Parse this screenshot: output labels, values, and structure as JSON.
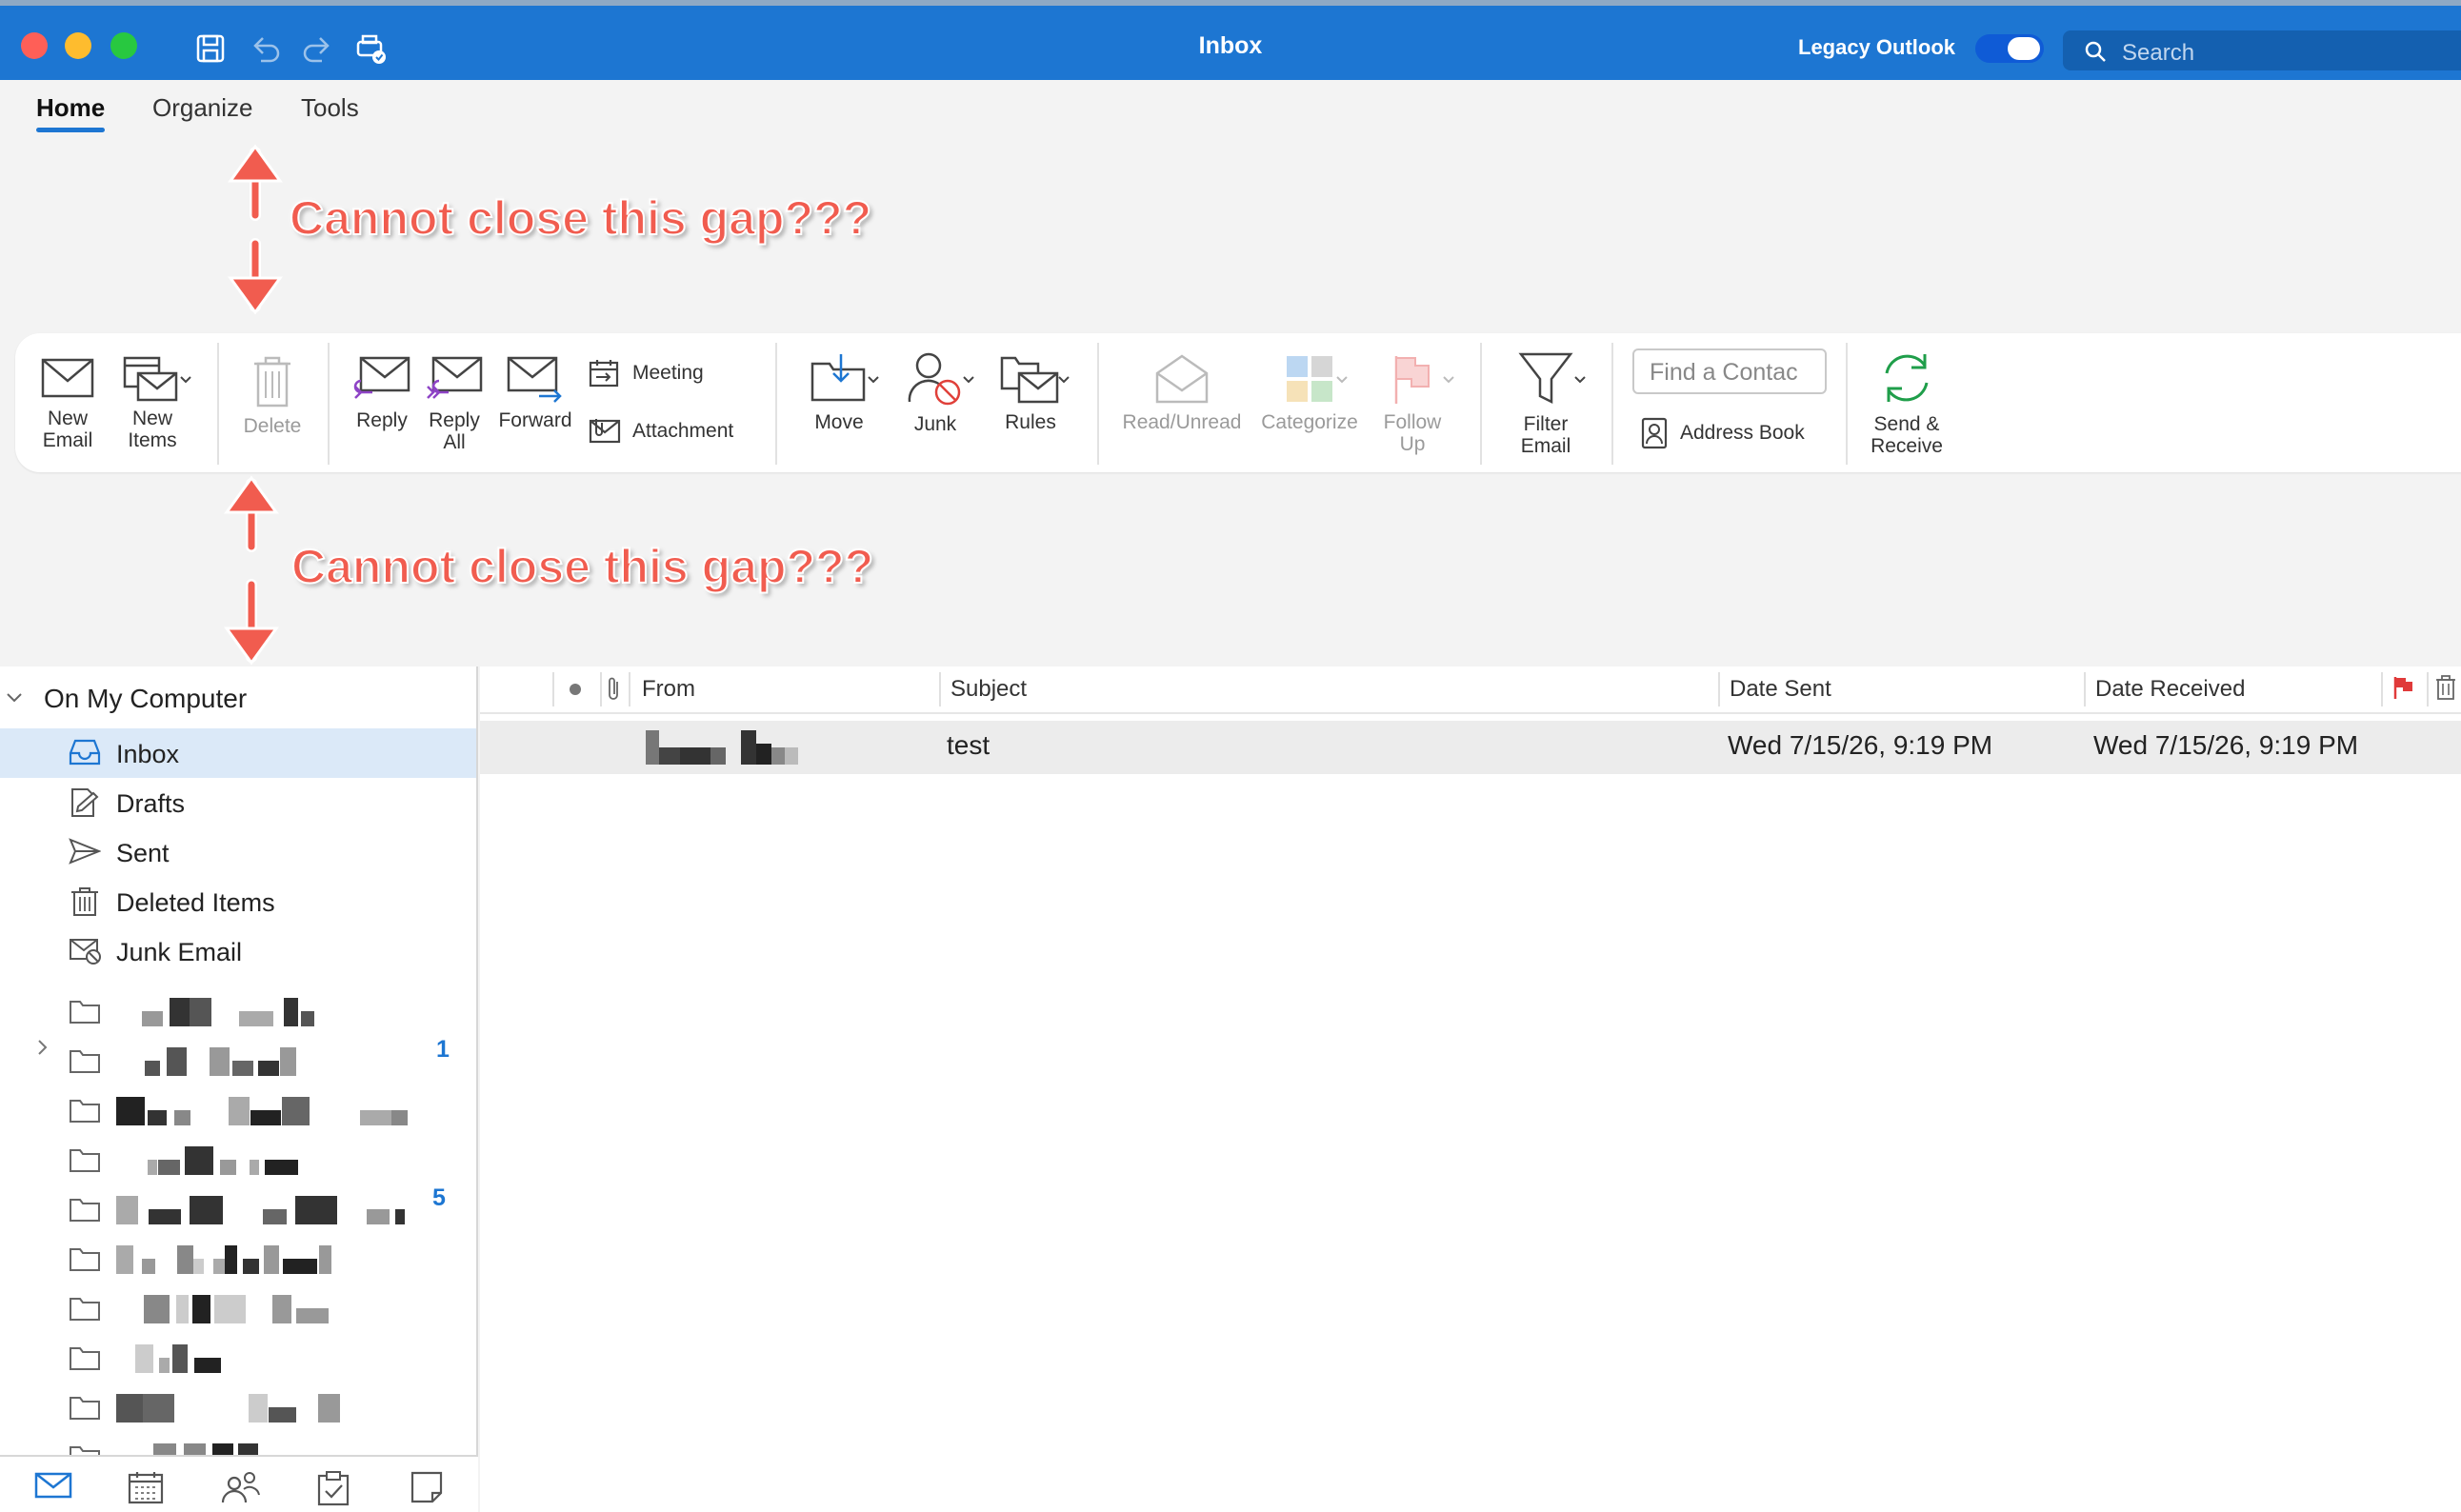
{
  "window": {
    "title": "Inbox",
    "legacy_label": "Legacy Outlook",
    "legacy_on": true,
    "search_placeholder": "Search"
  },
  "tabs": [
    {
      "label": "Home",
      "active": true
    },
    {
      "label": "Organize",
      "active": false
    },
    {
      "label": "Tools",
      "active": false
    }
  ],
  "ribbon": {
    "new_email": "New Email",
    "new_items": "New Items",
    "delete": "Delete",
    "reply": "Reply",
    "reply_all": "Reply All",
    "forward": "Forward",
    "meeting": "Meeting",
    "attachment": "Attachment",
    "move": "Move",
    "junk": "Junk",
    "rules": "Rules",
    "read_unread": "Read/Unread",
    "categorize": "Categorize",
    "follow_up": "Follow Up",
    "filter_email": "Filter Email",
    "find_contact": "Find a Contac",
    "address_book": "Address Book",
    "send_receive": "Send & Receive"
  },
  "annotations": {
    "top": "Cannot close this gap???",
    "bottom": "Cannot close this gap???"
  },
  "sidebar": {
    "section": "On My Computer",
    "folders": [
      {
        "label": "Inbox",
        "icon": "inbox-icon",
        "selected": true
      },
      {
        "label": "Drafts",
        "icon": "drafts-icon"
      },
      {
        "label": "Sent",
        "icon": "sent-icon"
      },
      {
        "label": "Deleted Items",
        "icon": "trash-icon"
      },
      {
        "label": "Junk Email",
        "icon": "junk-icon"
      }
    ],
    "badges": [
      "1",
      "5"
    ]
  },
  "message_list": {
    "columns": [
      "From",
      "Subject",
      "Date Sent",
      "Date Received"
    ],
    "rows": [
      {
        "subject": "test",
        "date_sent": "Wed 7/15/26, 9:19 PM",
        "date_received": "Wed 7/15/26, 9:19 PM"
      }
    ]
  },
  "colors": {
    "accent": "#1d76d2",
    "annotation": "#f15c4f"
  }
}
